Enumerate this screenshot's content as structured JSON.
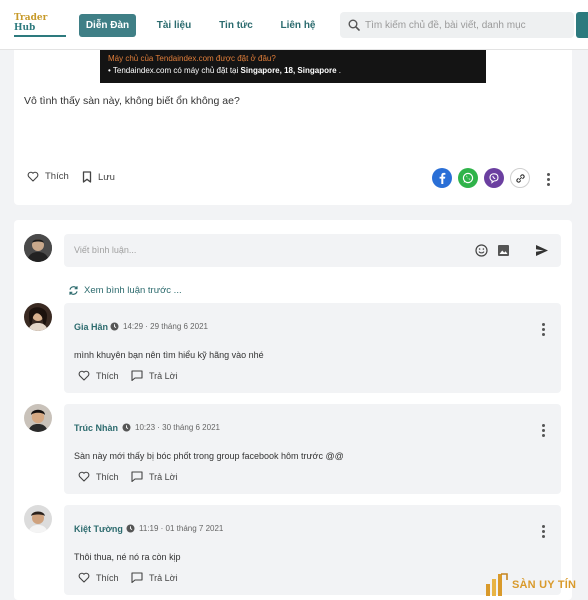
{
  "header": {
    "logo_line1": "Trader",
    "logo_line2": "Hub",
    "nav": [
      "Diễn Đàn",
      "Tài liệu",
      "Tin tức",
      "Liên hệ"
    ],
    "search_placeholder": "Tìm kiếm chủ đề, bài viết, danh mục",
    "accent": "#3f7f86"
  },
  "post": {
    "embed_question": "Máy chủ của Tendaindex.com được đặt ở đâu?",
    "embed_answer_prefix": "• Tendaindex.com có máy chủ đặt tại ",
    "embed_answer_bold": "Singapore, 18, Singapore",
    "embed_answer_suffix": " .",
    "text": "Vô tình thấy sàn này, không biết ổn không ae?",
    "like_label": "Thích",
    "save_label": "Lưu",
    "share_icons": [
      "facebook-icon",
      "whatsapp-icon",
      "viber-icon",
      "link-icon"
    ]
  },
  "comments": {
    "input_placeholder": "Viết bình luận...",
    "load_previous": "Xem bình luận trước ...",
    "items": [
      {
        "name": "Gia Hân",
        "time": "14:29 · 29 tháng 6 2021",
        "text": "mình khuyên bạn nên tìm hiểu kỹ hãng vào nhé",
        "like": "Thích",
        "reply": "Trả Lời"
      },
      {
        "name": "Trúc Nhàn",
        "time": "10:23 · 30 tháng 6 2021",
        "text": "Sàn này mới thấy bị bóc phốt trong group facebook hôm trước @@",
        "like": "Thích",
        "reply": "Trả Lời"
      },
      {
        "name": "Kiệt Tường",
        "time": "11:19 · 01 tháng 7 2021",
        "text": "Thôi thua, né nó ra còn kịp",
        "like": "Thích",
        "reply": "Trả Lời"
      }
    ]
  },
  "watermark": {
    "text": "SÀN UY TÍN"
  }
}
